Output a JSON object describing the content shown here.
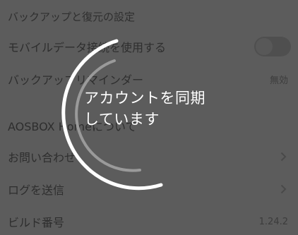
{
  "settings": {
    "section_title": "バックアップと復元の設定",
    "mobile_data": {
      "label": "モバイルデータ接続を使用する",
      "enabled": false
    },
    "backup_reminder": {
      "label": "バックアップリマインダー",
      "value": "無効"
    },
    "about": {
      "label": "AOSBOX Homeについて"
    },
    "contact": {
      "label": "お問い合わせ"
    },
    "send_log": {
      "label": "ログを送信"
    },
    "build_number": {
      "label": "ビルド番号",
      "value": "1.24.2"
    }
  },
  "loading": {
    "message": "アカウントを同期しています"
  },
  "colors": {
    "background": "#5c5c5c",
    "spinner": "#ffffff",
    "text": "#ffffff"
  },
  "icons": {
    "chevron": "chevron-right-icon"
  }
}
